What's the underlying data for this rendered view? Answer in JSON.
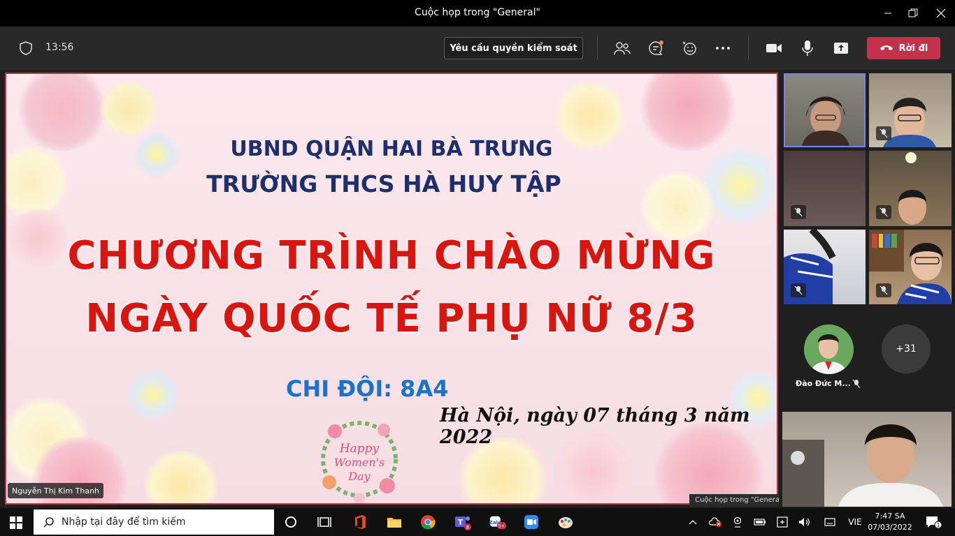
{
  "window": {
    "title": "Cuộc họp trong \"General\"",
    "minimize_icon": "minimize-icon",
    "maximize_icon": "maximize-icon",
    "close_icon": "close-icon"
  },
  "meeting_bar": {
    "time": "13:56",
    "request_control_label": "Yêu cầu quyền kiểm soát",
    "leave_label": "Rời đi",
    "icons": [
      "people-icon",
      "chat-icon",
      "reaction-icon",
      "more-icon",
      "camera-icon",
      "mic-icon",
      "share-icon",
      "phone-hangup-icon"
    ]
  },
  "slide": {
    "line1": "UBND QUẬN HAI BÀ TRƯNG",
    "line2": "TRƯỜNG THCS HÀ HUY TẬP",
    "line3": "CHƯƠNG TRÌNH CHÀO MỪNG",
    "line4": "NGÀY QUỐC TẾ PHỤ NỮ 8/3",
    "line5": "CHI ĐỘI: 8A4",
    "line6": "Hà Nội, ngày 07 tháng 3 năm 2022",
    "badge_l1": "Happy",
    "badge_l2": "Women's",
    "badge_l3": "Day"
  },
  "presenter": {
    "name": "Nguyễn Thị Kim Thanh"
  },
  "participants": {
    "avatar_name": "Đào Đức M...",
    "more_count": "+31",
    "mini_window_caption": "Cuộc họp trong \"General\""
  },
  "taskbar": {
    "search_placeholder": "Nhập tại đây để tìm kiếm",
    "teams_badge": "8",
    "zalo_badge": "5+",
    "language": "VIE",
    "time": "7:47 SA",
    "date": "07/03/2022",
    "notification_count": "1"
  },
  "colors": {
    "leave_red": "#c4314b",
    "slide_title_blue": "#1e2f6b",
    "slide_red": "#d8150f",
    "slide_subtitle_blue": "#1a73c9",
    "active_speaker_border": "#7b83eb"
  }
}
